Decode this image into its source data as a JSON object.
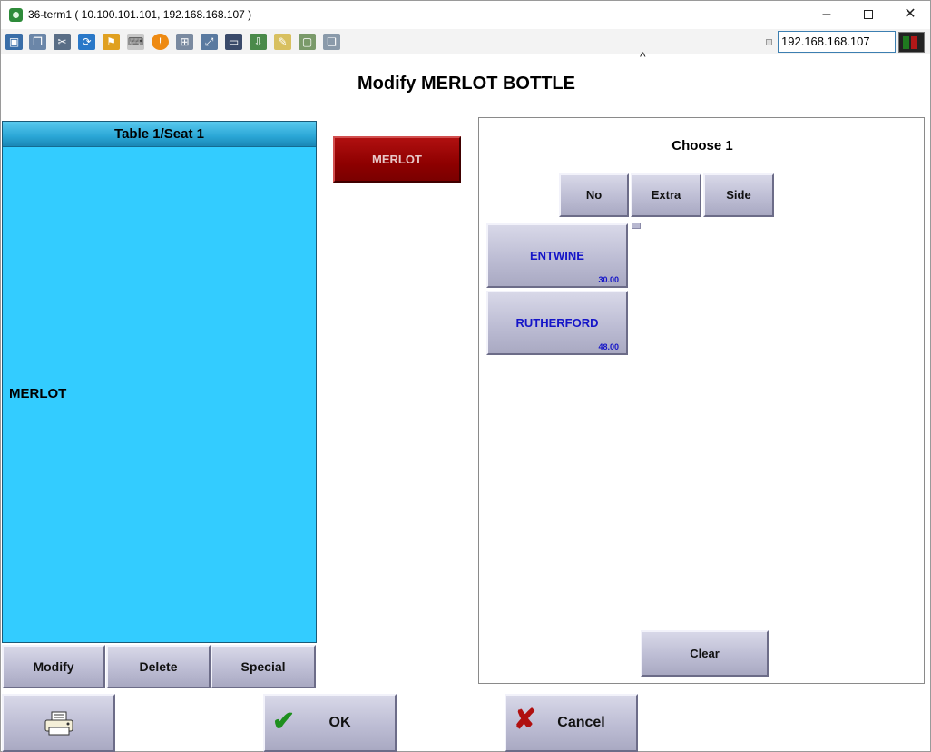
{
  "window": {
    "title": "36-term1 ( 10.100.101.101, 192.168.168.107 )",
    "ip_field": "192.168.168.107"
  },
  "toolbar": {
    "icons": [
      "monitor-icon",
      "windows-icon",
      "tools-icon",
      "refresh-icon",
      "flag-icon",
      "keyboard-icon",
      "alert-icon",
      "network-icon",
      "fullscreen-icon",
      "display-icon",
      "transfer-icon",
      "notes-icon",
      "image-icon",
      "chat-icon"
    ]
  },
  "page": {
    "title": "Modify MERLOT BOTTLE"
  },
  "seat_panel": {
    "header": "Table 1/Seat 1",
    "items": [
      "MERLOT"
    ],
    "buttons": {
      "modify": "Modify",
      "delete": "Delete",
      "special": "Special"
    }
  },
  "selected_item": {
    "label": "MERLOT",
    "color": "#8e0000"
  },
  "modifier_panel": {
    "prompt": "Choose 1",
    "qualifiers": {
      "no": "No",
      "extra": "Extra",
      "side": "Side"
    },
    "options": [
      {
        "name": "ENTWINE",
        "price": "30.00"
      },
      {
        "name": "RUTHERFORD",
        "price": "48.00"
      }
    ],
    "clear": "Clear"
  },
  "footer": {
    "ok": "OK",
    "cancel": "Cancel",
    "print_icon": "printer-icon"
  },
  "colors": {
    "seat_panel_bg": "#33ccff",
    "option_text": "#1515c8"
  }
}
